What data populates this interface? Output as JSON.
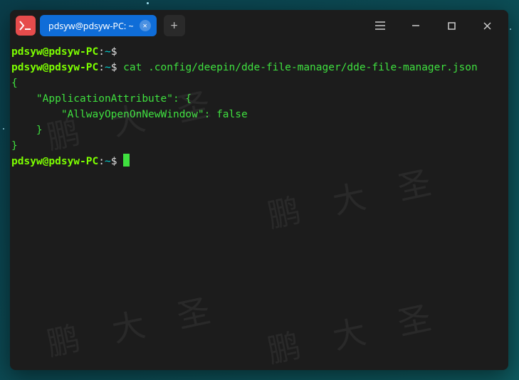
{
  "titlebar": {
    "tab_label": "pdsyw@pdsyw-PC: ~",
    "tab_close_glyph": "×",
    "new_tab_glyph": "+"
  },
  "prompt": {
    "user": "pdsyw@pdsyw-PC",
    "sep1": ":",
    "path": "~",
    "symbol": "$"
  },
  "lines": {
    "l1_cmd": "",
    "l2_cmd": "cat .config/deepin/dde-file-manager/dde-file-manager.json",
    "out1": "{",
    "out2": "    \"ApplicationAttribute\": {",
    "out3": "        \"AllwayOpenOnNewWindow\": false",
    "out4": "    }",
    "out5": "}"
  },
  "watermark_text": "鹏 大 圣"
}
